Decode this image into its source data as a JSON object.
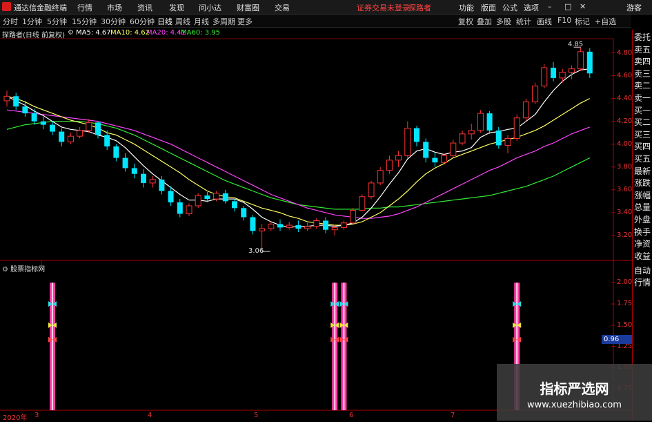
{
  "app": {
    "title": "通达信金融终端",
    "login": "游客",
    "security_note": "证券交易未登录",
    "stock_name": "探路者"
  },
  "menu": [
    "行情",
    "市场",
    "资讯",
    "发现",
    "问小达",
    "财富圈",
    "交易"
  ],
  "menu_right": [
    "功能",
    "版面",
    "公式",
    "选项"
  ],
  "periods": [
    "分时",
    "1分钟",
    "5分钟",
    "15分钟",
    "30分钟",
    "60分钟",
    "日线",
    "周线",
    "月线",
    "多周期",
    "更多"
  ],
  "active_period": "日线",
  "toolbar_right": [
    "复权",
    "叠加",
    "多股",
    "统计",
    "画线",
    "F10",
    "标记",
    "+自选"
  ],
  "chart_title": "探路者(日线 前复权)",
  "ma": [
    {
      "label": "MA5: 4.67",
      "color": "#ffffff"
    },
    {
      "label": "MA10: 4.62",
      "color": "#ffff66"
    },
    {
      "label": "MA20: 4.41",
      "color": "#ff44ff"
    },
    {
      "label": "MA60: 3.95",
      "color": "#33ee33"
    }
  ],
  "price_ticks": [
    "4.80",
    "4.60",
    "4.40",
    "4.20",
    "4.00",
    "3.80",
    "3.60",
    "3.40",
    "3.20"
  ],
  "annotations": {
    "high": "4.85",
    "low": "3.06"
  },
  "subchart": {
    "title": "股票指标网",
    "value_label": "0.96",
    "ticks": [
      "2.00",
      "1.75",
      "1.50",
      "1.25",
      "1.00",
      "0.75"
    ]
  },
  "x_labels": [
    "2020年",
    "3",
    "4",
    "5",
    "6",
    "7"
  ],
  "right_panel": [
    "委托",
    "卖五",
    "卖四",
    "卖三",
    "卖二",
    "卖一",
    "买一",
    "买二",
    "买三",
    "买四",
    "买五",
    "最新",
    "涨跌",
    "涨幅",
    "总量",
    "外盘",
    "换手",
    "净资",
    "收益"
  ],
  "right_panel_bottom": [
    "自动",
    "行情"
  ],
  "watermark": {
    "title": "指标严选网",
    "url": "www.xuezhibiao.com"
  },
  "colors": {
    "up": "#ff3333",
    "down": "#00e6ff",
    "ma5": "#ffffff",
    "ma10": "#ffff66",
    "ma20": "#ff44ff",
    "ma60": "#33ee33",
    "signal": "#ff66cc"
  },
  "chart_data": {
    "type": "candlestick",
    "title": "探路者(日线 前复权)",
    "ylim": [
      3.0,
      4.9
    ],
    "ohlc": [
      [
        4.38,
        4.47,
        4.33,
        4.42
      ],
      [
        4.42,
        4.45,
        4.3,
        4.33
      ],
      [
        4.33,
        4.38,
        4.24,
        4.27
      ],
      [
        4.27,
        4.31,
        4.17,
        4.2
      ],
      [
        4.2,
        4.24,
        4.13,
        4.17
      ],
      [
        4.17,
        4.2,
        4.08,
        4.11
      ],
      [
        4.11,
        4.14,
        3.98,
        4.02
      ],
      [
        4.02,
        4.1,
        4.0,
        4.07
      ],
      [
        4.07,
        4.15,
        4.05,
        4.12
      ],
      [
        4.12,
        4.22,
        4.1,
        4.19
      ],
      [
        4.19,
        4.2,
        4.05,
        4.08
      ],
      [
        4.08,
        4.12,
        3.95,
        3.98
      ],
      [
        3.98,
        4.0,
        3.85,
        3.88
      ],
      [
        3.88,
        3.92,
        3.76,
        3.79
      ],
      [
        3.79,
        3.83,
        3.7,
        3.74
      ],
      [
        3.74,
        3.78,
        3.62,
        3.66
      ],
      [
        3.66,
        3.72,
        3.62,
        3.69
      ],
      [
        3.69,
        3.72,
        3.56,
        3.59
      ],
      [
        3.59,
        3.63,
        3.46,
        3.49
      ],
      [
        3.49,
        3.52,
        3.36,
        3.39
      ],
      [
        3.39,
        3.48,
        3.37,
        3.46
      ],
      [
        3.46,
        3.57,
        3.44,
        3.55
      ],
      [
        3.55,
        3.58,
        3.49,
        3.52
      ],
      [
        3.52,
        3.59,
        3.5,
        3.57
      ],
      [
        3.57,
        3.6,
        3.48,
        3.5
      ],
      [
        3.5,
        3.52,
        3.41,
        3.44
      ],
      [
        3.44,
        3.46,
        3.33,
        3.36
      ],
      [
        3.36,
        3.38,
        3.21,
        3.24
      ],
      [
        3.24,
        3.3,
        3.06,
        3.26
      ],
      [
        3.26,
        3.32,
        3.24,
        3.3
      ],
      [
        3.3,
        3.34,
        3.24,
        3.27
      ],
      [
        3.27,
        3.32,
        3.25,
        3.29
      ],
      [
        3.29,
        3.33,
        3.23,
        3.26
      ],
      [
        3.26,
        3.31,
        3.24,
        3.28
      ],
      [
        3.28,
        3.35,
        3.26,
        3.33
      ],
      [
        3.33,
        3.36,
        3.22,
        3.25
      ],
      [
        3.25,
        3.29,
        3.2,
        3.27
      ],
      [
        3.27,
        3.33,
        3.25,
        3.31
      ],
      [
        3.31,
        3.44,
        3.3,
        3.42
      ],
      [
        3.42,
        3.56,
        3.41,
        3.54
      ],
      [
        3.54,
        3.68,
        3.52,
        3.66
      ],
      [
        3.66,
        3.8,
        3.64,
        3.77
      ],
      [
        3.77,
        3.9,
        3.74,
        3.86
      ],
      [
        3.86,
        3.94,
        3.8,
        3.9
      ],
      [
        3.9,
        4.2,
        3.88,
        4.14
      ],
      [
        4.14,
        4.16,
        3.98,
        4.02
      ],
      [
        4.02,
        4.05,
        3.84,
        3.88
      ],
      [
        3.88,
        3.93,
        3.8,
        3.84
      ],
      [
        3.84,
        3.92,
        3.82,
        3.9
      ],
      [
        3.9,
        4.04,
        3.88,
        4.01
      ],
      [
        4.01,
        4.12,
        3.99,
        4.09
      ],
      [
        4.09,
        4.18,
        4.04,
        4.12
      ],
      [
        4.12,
        4.3,
        4.1,
        4.27
      ],
      [
        4.27,
        4.29,
        4.09,
        4.12
      ],
      [
        4.12,
        4.15,
        3.96,
        3.99
      ],
      [
        3.99,
        4.08,
        3.92,
        4.05
      ],
      [
        4.05,
        4.26,
        4.03,
        4.23
      ],
      [
        4.23,
        4.4,
        4.2,
        4.37
      ],
      [
        4.37,
        4.54,
        4.35,
        4.51
      ],
      [
        4.51,
        4.7,
        4.49,
        4.67
      ],
      [
        4.67,
        4.72,
        4.55,
        4.58
      ],
      [
        4.58,
        4.66,
        4.54,
        4.63
      ],
      [
        4.63,
        4.69,
        4.57,
        4.66
      ],
      [
        4.66,
        4.85,
        4.64,
        4.81
      ],
      [
        4.81,
        4.84,
        4.58,
        4.62
      ]
    ],
    "ma5": [
      4.42,
      4.38,
      4.34,
      4.29,
      4.25,
      4.2,
      4.15,
      4.13,
      4.12,
      4.11,
      4.08,
      4.06,
      4.03,
      3.97,
      3.89,
      3.81,
      3.74,
      3.68,
      3.62,
      3.56,
      3.51,
      3.51,
      3.5,
      3.52,
      3.52,
      3.52,
      3.49,
      3.43,
      3.36,
      3.32,
      3.29,
      3.27,
      3.28,
      3.28,
      3.29,
      3.29,
      3.28,
      3.29,
      3.31,
      3.36,
      3.44,
      3.54,
      3.65,
      3.75,
      3.87,
      3.94,
      3.96,
      3.93,
      3.91,
      3.93,
      3.94,
      3.97,
      4.06,
      4.1,
      4.11,
      4.13,
      4.14,
      4.2,
      4.26,
      4.37,
      4.47,
      4.55,
      4.61,
      4.65,
      4.66
    ],
    "ma10": [
      4.42,
      4.4,
      4.37,
      4.33,
      4.3,
      4.27,
      4.24,
      4.21,
      4.19,
      4.17,
      4.14,
      4.1,
      4.08,
      4.04,
      4.0,
      3.95,
      3.9,
      3.85,
      3.8,
      3.75,
      3.69,
      3.64,
      3.59,
      3.56,
      3.54,
      3.53,
      3.5,
      3.47,
      3.44,
      3.42,
      3.4,
      3.37,
      3.35,
      3.32,
      3.31,
      3.3,
      3.29,
      3.29,
      3.3,
      3.32,
      3.36,
      3.4,
      3.46,
      3.52,
      3.59,
      3.67,
      3.74,
      3.79,
      3.83,
      3.88,
      3.91,
      3.94,
      3.97,
      4.0,
      4.02,
      4.04,
      4.06,
      4.09,
      4.12,
      4.16,
      4.21,
      4.26,
      4.31,
      4.36,
      4.4
    ],
    "ma20": [
      4.3,
      4.29,
      4.28,
      4.27,
      4.26,
      4.25,
      4.24,
      4.23,
      4.22,
      4.21,
      4.2,
      4.18,
      4.16,
      4.14,
      4.12,
      4.09,
      4.06,
      4.03,
      4.0,
      3.96,
      3.92,
      3.88,
      3.84,
      3.8,
      3.76,
      3.72,
      3.68,
      3.64,
      3.6,
      3.56,
      3.53,
      3.5,
      3.47,
      3.44,
      3.42,
      3.4,
      3.38,
      3.37,
      3.36,
      3.35,
      3.35,
      3.36,
      3.37,
      3.39,
      3.42,
      3.45,
      3.49,
      3.53,
      3.57,
      3.61,
      3.65,
      3.69,
      3.73,
      3.77,
      3.8,
      3.84,
      3.88,
      3.91,
      3.94,
      3.98,
      4.01,
      4.05,
      4.09,
      4.12,
      4.15
    ],
    "ma60": [
      4.13,
      4.15,
      4.17,
      4.18,
      4.19,
      4.2,
      4.2,
      4.2,
      4.2,
      4.19,
      4.18,
      4.16,
      4.14,
      4.11,
      4.08,
      4.04,
      4.0,
      3.96,
      3.92,
      3.88,
      3.84,
      3.8,
      3.76,
      3.72,
      3.68,
      3.65,
      3.62,
      3.59,
      3.56,
      3.53,
      3.51,
      3.49,
      3.47,
      3.46,
      3.45,
      3.44,
      3.43,
      3.43,
      3.43,
      3.43,
      3.44,
      3.44,
      3.45,
      3.45,
      3.46,
      3.47,
      3.48,
      3.49,
      3.5,
      3.51,
      3.52,
      3.53,
      3.54,
      3.55,
      3.57,
      3.59,
      3.61,
      3.63,
      3.66,
      3.69,
      3.72,
      3.76,
      3.8,
      3.84,
      3.88
    ],
    "signals": [
      5,
      36,
      37,
      56
    ]
  }
}
